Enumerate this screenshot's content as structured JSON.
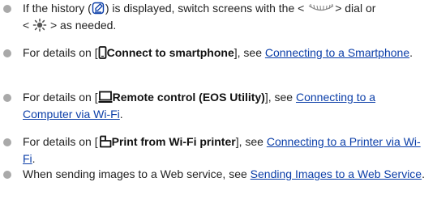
{
  "notes": [
    {
      "part1": "If the history (",
      "history_icon": "history-icon",
      "part2": ") is displayed, switch screens with the <",
      "dial_icon": "main-dial-icon",
      "part3": "> dial or",
      "part4": "<",
      "multi_icon": "multi-controller-icon",
      "part5": "> as needed."
    },
    {
      "prefix": "For details on [",
      "icon": "smartphone-icon",
      "bold": "Connect to smartphone",
      "mid": "], see ",
      "link": "Connecting to a Smartphone",
      "suffix": "."
    },
    {
      "prefix": "For details on [",
      "icon": "computer-icon",
      "bold": "Remote control (EOS Utility)",
      "mid": "], see ",
      "link": "Connecting to a Computer via Wi-Fi",
      "suffix": "."
    },
    {
      "prefix": "For details on [",
      "icon": "printer-icon",
      "bold": "Print from Wi-Fi printer",
      "mid": "], see ",
      "link": "Connecting to a Printer via Wi-Fi",
      "suffix": "."
    },
    {
      "prefix": "When sending images to a Web service, see ",
      "link": "Sending Images to a Web Service",
      "suffix": "."
    }
  ],
  "colors": {
    "bullet": "#a9a9a9",
    "link": "#0b3ea8",
    "text": "#222222"
  }
}
